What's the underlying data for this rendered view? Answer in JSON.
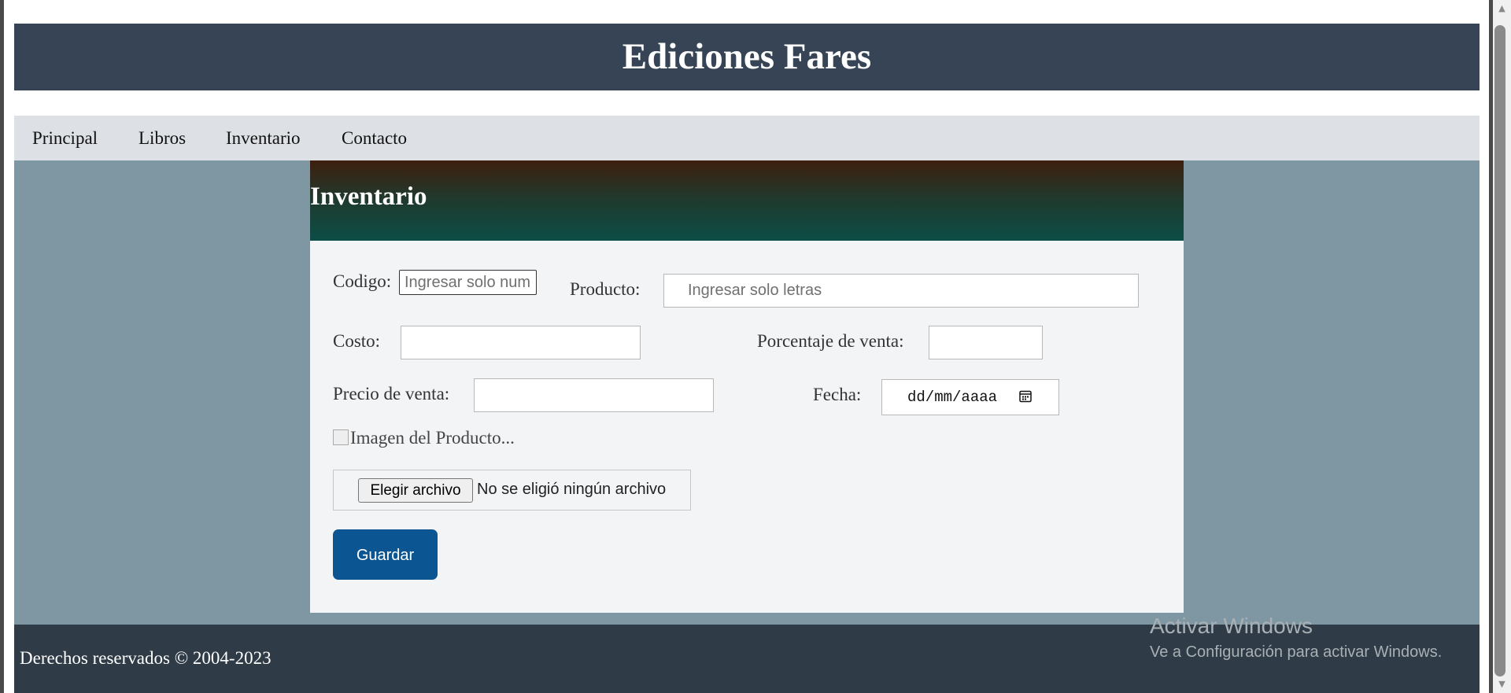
{
  "header": {
    "title": "Ediciones Fares"
  },
  "nav": {
    "items": [
      {
        "label": "Principal"
      },
      {
        "label": "Libros"
      },
      {
        "label": "Inventario"
      },
      {
        "label": "Contacto"
      }
    ]
  },
  "card": {
    "title": "Inventario",
    "fields": {
      "codigo": {
        "label": "Codigo:",
        "placeholder": "Ingresar solo numeros",
        "value": ""
      },
      "producto": {
        "label": "Producto:",
        "placeholder": "Ingresar solo letras",
        "value": ""
      },
      "costo": {
        "label": "Costo:",
        "value": ""
      },
      "porcentaje": {
        "label": "Porcentaje de venta:",
        "value": ""
      },
      "precio": {
        "label": "Precio de venta:",
        "value": ""
      },
      "fecha": {
        "label": "Fecha:",
        "value": "dd/mm/aaaa"
      }
    },
    "image_alt": "Imagen del Producto...",
    "file": {
      "button_label": "Elegir archivo",
      "status": "No se eligió ningún archivo"
    },
    "save_label": "Guardar"
  },
  "footer": {
    "text": "Derechos reservados © 2004-2023"
  },
  "watermark": {
    "title": "Activar Windows",
    "subtitle": "Ve a Configuración para activar Windows."
  },
  "colors": {
    "header_bg": "#364456",
    "nav_bg": "#dde1e5",
    "main_bg": "#7f96a3",
    "card_bg": "#f3f4f6",
    "save_button_bg": "#0b5592",
    "footer_bg": "#2f3b46"
  },
  "icons": {
    "date_picker": "calendar-icon",
    "image": "broken-image-icon"
  }
}
